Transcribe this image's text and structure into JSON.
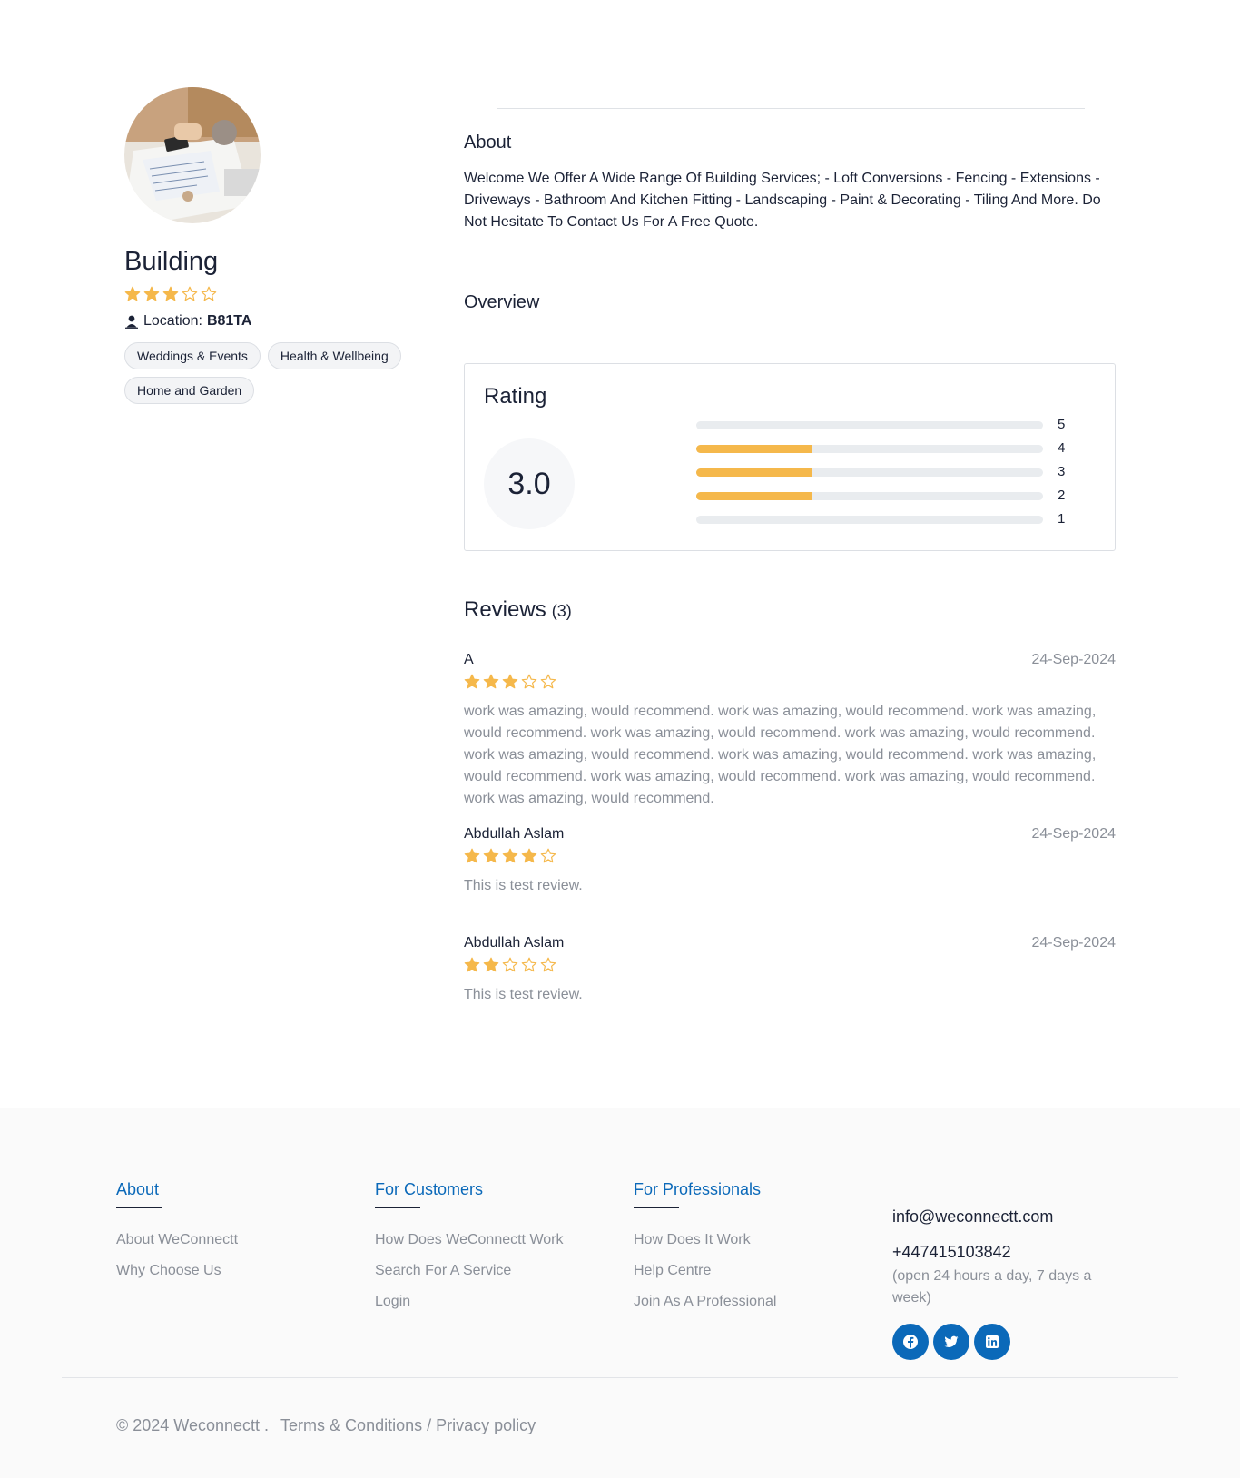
{
  "profile": {
    "name": "Building",
    "rating_stars": 3,
    "location_label": "Location:",
    "location_value": "B81TA",
    "tags": [
      "Weddings & Events",
      "Health & Wellbeing",
      "Home and Garden"
    ]
  },
  "about": {
    "heading": "About",
    "text": "Welcome We Offer A Wide Range Of Building Services; - Loft Conversions - Fencing - Extensions - Driveways - Bathroom And Kitchen Fitting - Landscaping - Paint & Decorating - Tiling And More. Do Not Hesitate To Contact Us For A Free Quote."
  },
  "overview": {
    "heading": "Overview",
    "rating_title": "Rating",
    "score": "3.0",
    "breakdown": [
      {
        "label": "5",
        "fraction": 0.0
      },
      {
        "label": "4",
        "fraction": 0.3333
      },
      {
        "label": "3",
        "fraction": 0.3333
      },
      {
        "label": "2",
        "fraction": 0.3333
      },
      {
        "label": "1",
        "fraction": 0.0
      }
    ]
  },
  "reviews": {
    "heading": "Reviews",
    "count": "(3)",
    "items": [
      {
        "name": "A",
        "date": "24-Sep-2024",
        "stars": 3,
        "text": "work was amazing, would recommend. work was amazing, would recommend. work was amazing, would recommend. work was amazing, would recommend. work was amazing, would recommend. work was amazing, would recommend. work was amazing, would recommend. work was amazing, would recommend. work was amazing, would recommend. work was amazing, would recommend. work was amazing, would recommend."
      },
      {
        "name": "Abdullah Aslam",
        "date": "24-Sep-2024",
        "stars": 4,
        "text": "This is test review."
      },
      {
        "name": "Abdullah Aslam",
        "date": "24-Sep-2024",
        "stars": 2,
        "text": "This is test review."
      }
    ]
  },
  "footer": {
    "about": {
      "heading": "About",
      "links": [
        "About WeConnectt",
        "Why Choose Us"
      ]
    },
    "customers": {
      "heading": "For Customers",
      "links": [
        "How Does WeConnectt Work",
        "Search For A Service",
        "Login"
      ]
    },
    "professionals": {
      "heading": "For Professionals",
      "links": [
        "How Does It Work",
        "Help Centre",
        "Join As A Professional"
      ]
    },
    "email": "info@weconnectt.com",
    "phone": "+447415103842",
    "hours": "(open 24 hours a day, 7 days a week)",
    "socials": [
      "facebook-icon",
      "twitter-icon",
      "linkedin-icon"
    ],
    "copyright": "© 2024 Weconnectt .",
    "legal": "Terms & Conditions / Privacy policy"
  },
  "colors": {
    "star": "#f5b84b",
    "star_empty": "#f5b84b",
    "brand_blue": "#0b69b9",
    "muted": "#8a8f98"
  }
}
